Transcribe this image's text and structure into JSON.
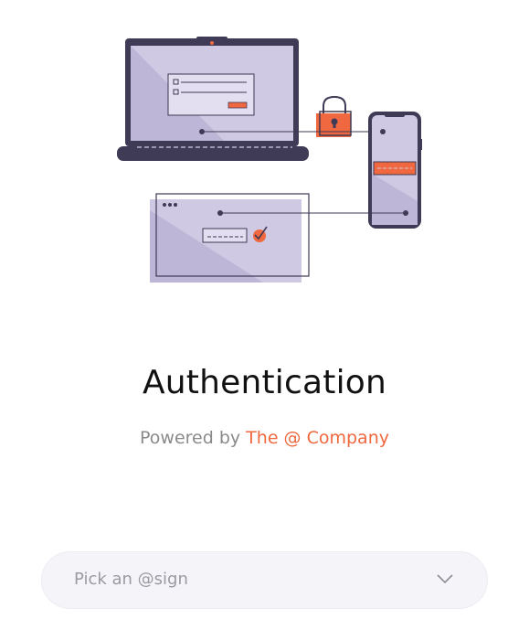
{
  "header": {
    "title": "Authentication",
    "powered_prefix": "Powered by",
    "powered_brand": "The @ Company"
  },
  "select": {
    "placeholder": "Pick an @sign"
  },
  "colors": {
    "accent": "#f0683f",
    "illustration_fill": "#cfc9e4",
    "illustration_dark": "#3f3a55"
  },
  "icons": {
    "hero": "authentication-devices-illustration",
    "dropdown": "chevron-down-icon"
  }
}
